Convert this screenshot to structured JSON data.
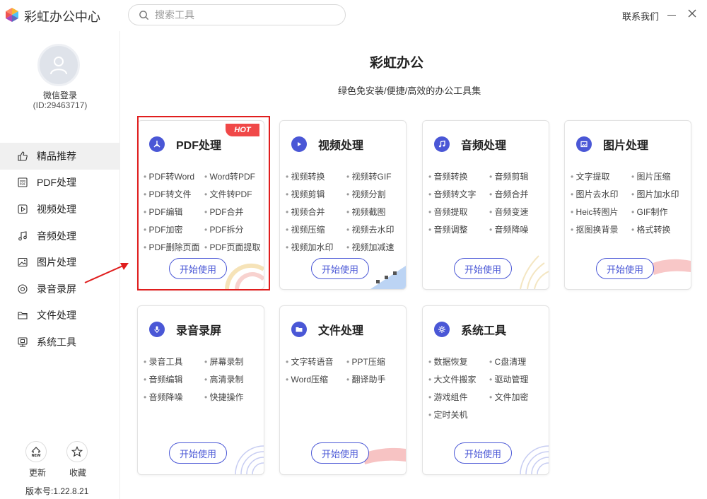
{
  "app": {
    "title": "彩虹办公中心",
    "search_placeholder": "搜索工具",
    "contact": "联系我们",
    "icons": {
      "logo": "rainbow-logo-icon",
      "search": "search-icon",
      "minimize": "minimize-icon",
      "close": "close-icon"
    }
  },
  "sidebar": {
    "login_label": "微信登录",
    "user_id": "(ID:29463717)",
    "items": [
      {
        "label": "精品推荐",
        "icon": "thumbs-up-icon",
        "active": true
      },
      {
        "label": "PDF处理",
        "icon": "pdf-icon",
        "active": false
      },
      {
        "label": "视频处理",
        "icon": "video-icon",
        "active": false
      },
      {
        "label": "音频处理",
        "icon": "music-icon",
        "active": false
      },
      {
        "label": "图片处理",
        "icon": "image-icon",
        "active": false
      },
      {
        "label": "录音录屏",
        "icon": "record-icon",
        "active": false
      },
      {
        "label": "文件处理",
        "icon": "folder-icon",
        "active": false
      },
      {
        "label": "系统工具",
        "icon": "monitor-icon",
        "active": false
      }
    ],
    "update_label": "更新",
    "favorite_label": "收藏",
    "version": "版本号:1.22.8.21"
  },
  "main": {
    "title": "彩虹办公",
    "subtitle": "绿色免安装/便捷/高效的办公工具集",
    "start_label": "开始使用",
    "hot_label": "HOT",
    "cards": [
      {
        "title": "PDF处理",
        "icon": "pdf-icon",
        "items": [
          "PDF转Word",
          "Word转PDF",
          "PDF转文件",
          "文件转PDF",
          "PDF编辑",
          "PDF合并",
          "PDF加密",
          "PDF拆分",
          "PDF删除页面",
          "PDF页面提取"
        ]
      },
      {
        "title": "视频处理",
        "icon": "play-icon",
        "items": [
          "视频转换",
          "视频转GIF",
          "视频剪辑",
          "视频分割",
          "视频合并",
          "视频截图",
          "视频压缩",
          "视频去水印",
          "视频加水印",
          "视频加减速"
        ]
      },
      {
        "title": "音频处理",
        "icon": "music-icon",
        "items": [
          "音频转换",
          "音频剪辑",
          "音频转文字",
          "音频合并",
          "音频提取",
          "音频变速",
          "音频调整",
          "音频降噪"
        ]
      },
      {
        "title": "图片处理",
        "icon": "image-icon",
        "items": [
          "文字提取",
          "图片压缩",
          "图片去水印",
          "图片加水印",
          "Heic转图片",
          "GIF制作",
          "抠图换背景",
          "格式转换"
        ]
      },
      {
        "title": "录音录屏",
        "icon": "microphone-icon",
        "items": [
          "录音工具",
          "屏幕录制",
          "音频编辑",
          "高清录制",
          "音频降噪",
          "快捷操作"
        ]
      },
      {
        "title": "文件处理",
        "icon": "folder-icon",
        "items": [
          "文字转语音",
          "PPT压缩",
          "Word压缩",
          "翻译助手"
        ]
      },
      {
        "title": "系统工具",
        "icon": "gear-icon",
        "items": [
          "数据恢复",
          "C盘清理",
          "大文件搬家",
          "驱动管理",
          "游戏组件",
          "文件加密",
          "定时关机"
        ]
      }
    ]
  },
  "colors": {
    "accent": "#4a57d6",
    "hot": "#f04848",
    "highlight": "#e01e1e"
  }
}
